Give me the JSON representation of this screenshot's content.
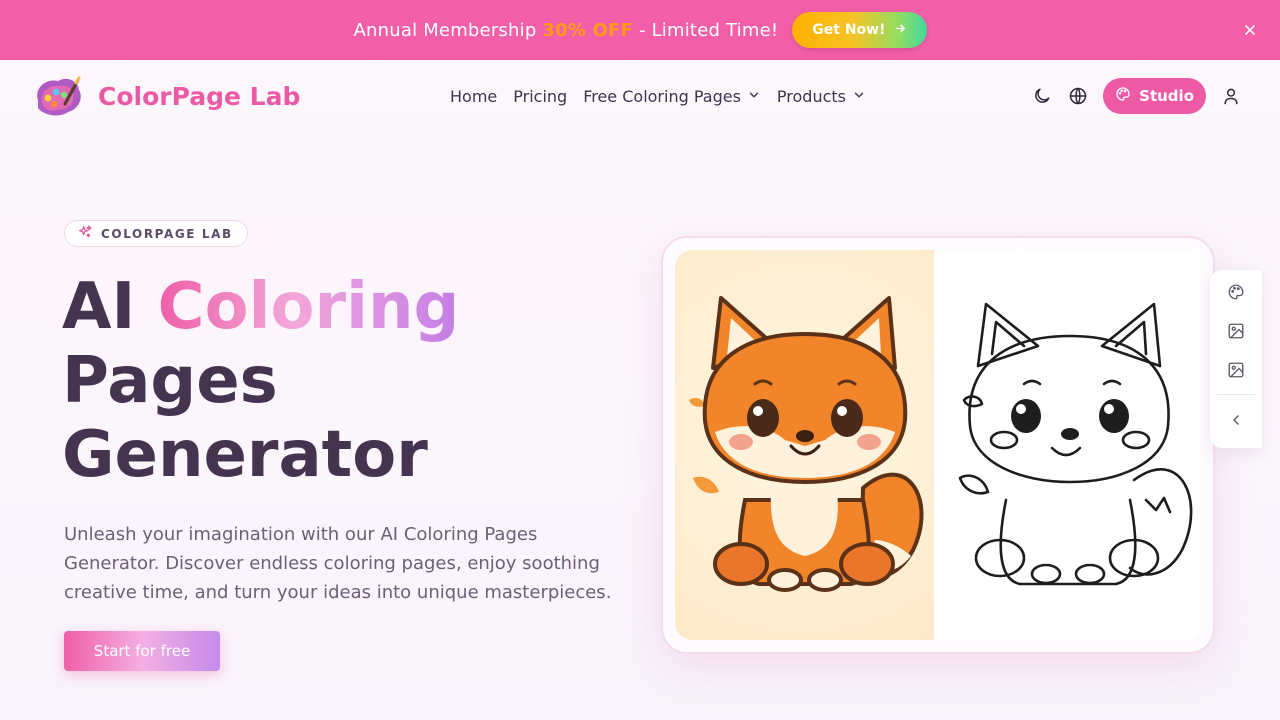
{
  "promo": {
    "text_before": "Annual Membership ",
    "highlight": "30% OFF",
    "text_after": " - Limited Time!",
    "cta_label": "Get Now!",
    "background": "#f25fa8",
    "highlight_color": "#ff9a18"
  },
  "header": {
    "brand": "ColorPage Lab",
    "brand_color": "#ec5aa6",
    "nav": [
      {
        "label": "Home"
      },
      {
        "label": "Pricing"
      },
      {
        "label": "Free Coloring Pages",
        "icon": "chevron-down-icon"
      },
      {
        "label": "Products",
        "icon": "chevron-down-icon"
      }
    ],
    "studio_label": "Studio",
    "icons": [
      "moon-icon",
      "globe-icon",
      "palette-icon",
      "user-icon"
    ]
  },
  "hero": {
    "badge": "COLORPAGE LAB",
    "title_line1_plain": "AI ",
    "title_line1_grad": "Coloring",
    "title_line2": "Pages",
    "title_line3": "Generator",
    "description": "Unleash your imagination with our AI Coloring Pages Generator. Discover endless coloring pages, enjoy soothing creative time, and turn your ideas into unique masterpieces.",
    "cta_label": "Start for free"
  },
  "preview": {
    "left_image": "colored-fox-illustration",
    "right_image": "fox-line-art-coloring-page"
  },
  "side_toolbar": {
    "icons": [
      "palette-icon",
      "image-icon",
      "image-icon",
      "chevron-left-icon"
    ]
  }
}
